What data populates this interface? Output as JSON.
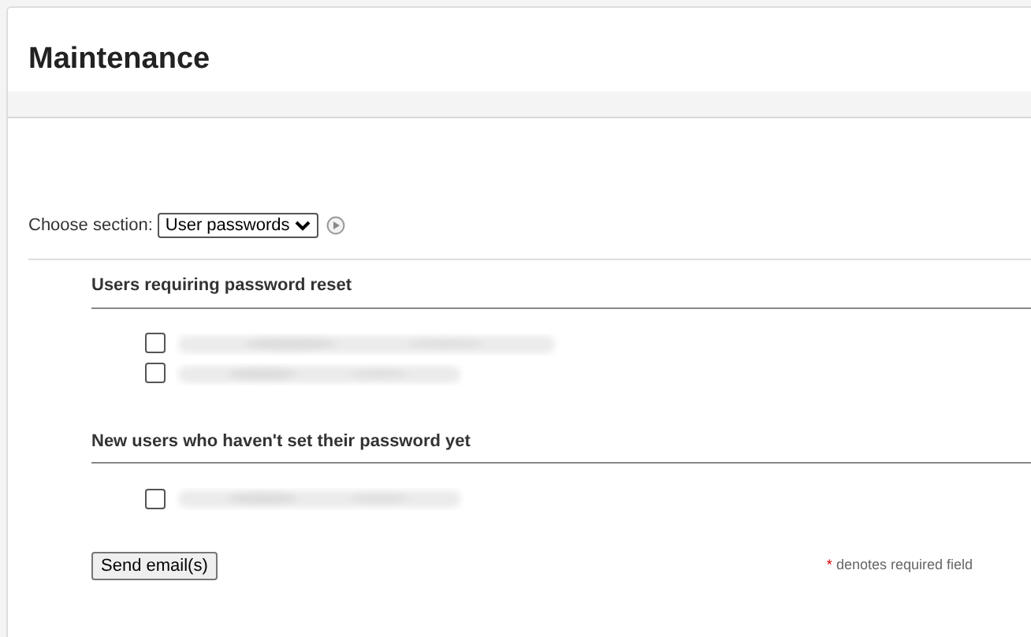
{
  "title": "Maintenance",
  "section_picker": {
    "label": "Choose section:",
    "value": "User passwords"
  },
  "groups": [
    {
      "heading": "Users requiring password reset",
      "users": [
        {
          "checked": false
        },
        {
          "checked": false
        }
      ]
    },
    {
      "heading": "New users who haven't set their password yet",
      "users": [
        {
          "checked": false
        }
      ]
    }
  ],
  "send_button": "Send email(s)",
  "required_note": {
    "mark": "*",
    "text": "denotes required field"
  }
}
